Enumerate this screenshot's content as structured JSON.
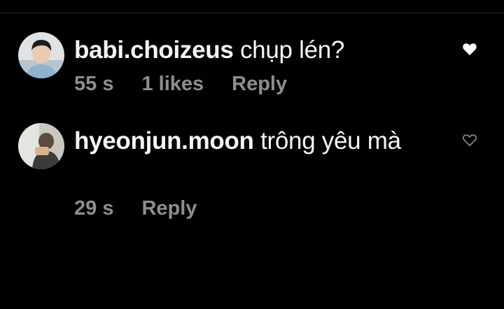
{
  "comments": [
    {
      "username": "babi.choizeus",
      "text": "chụp lén?",
      "time": "55 s",
      "likes": "1 likes",
      "reply": "Reply",
      "liked": true
    },
    {
      "username": "hyeonjun.moon",
      "text": "trông yêu mà",
      "time": "29 s",
      "reply": "Reply",
      "liked": false
    }
  ],
  "icons": {
    "like_filled": "heart-filled-icon",
    "like_outline": "heart-outline-icon"
  },
  "colors": {
    "background": "#000000",
    "text": "#f5f5f5",
    "meta": "#8e8e8e",
    "heart_outline": "#8e8e8e",
    "heart_filled": "#ffffff"
  }
}
